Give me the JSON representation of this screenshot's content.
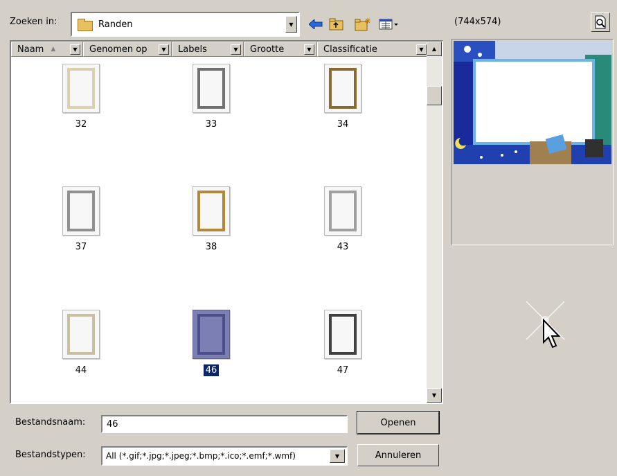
{
  "toolbar": {
    "look_in_label": "Zoeken in:",
    "look_in_value": "Randen",
    "preview_size": "(744x574)"
  },
  "columns": [
    {
      "label": "Naam",
      "sorted": true
    },
    {
      "label": "Genomen op"
    },
    {
      "label": "Labels"
    },
    {
      "label": "Grootte"
    },
    {
      "label": "Classificatie"
    }
  ],
  "items": [
    {
      "label": "32",
      "color": "#d8d0b0"
    },
    {
      "label": "33",
      "color": "#707070"
    },
    {
      "label": "34",
      "color": "#8a6a30"
    },
    {
      "label": "37",
      "color": "#909090"
    },
    {
      "label": "38",
      "color": "#b08a3a"
    },
    {
      "label": "43",
      "color": "#a0a0a0"
    },
    {
      "label": "44",
      "color": "#c8c0a0"
    },
    {
      "label": "46",
      "color": "#4a4f8a",
      "selected": true
    },
    {
      "label": "47",
      "color": "#404040"
    }
  ],
  "footer": {
    "filename_label": "Bestandsnaam:",
    "filename_value": "46",
    "filetype_label": "Bestandstypen:",
    "filetype_value": "All (*.gif;*.jpg;*.jpeg;*.bmp;*.ico;*.emf;*.wmf)",
    "open_label": "Openen",
    "cancel_label": "Annuleren"
  }
}
